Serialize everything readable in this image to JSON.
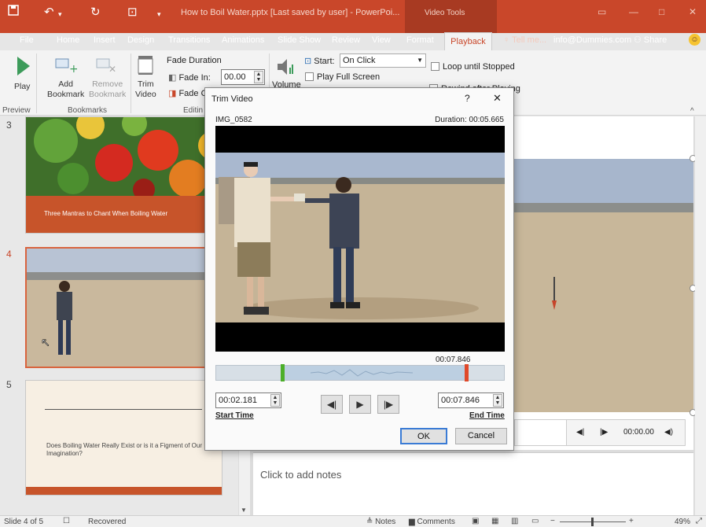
{
  "titlebar": {
    "save_icon": "save-icon",
    "undo": "↶",
    "undo_arrow": "▾",
    "redo": "↻",
    "present": "⊡",
    "customize": "▾",
    "doc_title": "How to Boil Water.pptx [Last saved by user] - PowerPoi...",
    "video_tools": "Video Tools",
    "min": "—",
    "max": "□",
    "close": "✕"
  },
  "tabs": [
    "File",
    "Home",
    "Insert",
    "Design",
    "Transitions",
    "Animations",
    "Slide Show",
    "Review",
    "View",
    "Format",
    "Playback"
  ],
  "tell_me": "♀ Tell me...",
  "account": "info@Dummies.com",
  "share": "Share",
  "smiley": "☺",
  "ribbon": {
    "play": "Play",
    "preview": "Preview",
    "add_bookmark": "Add\nBookmark",
    "remove_bookmark": "Remove\nBookmark",
    "bookmarks": "Bookmarks",
    "trim": "Trim\nVideo",
    "editing": "Editin",
    "fade_duration": "Fade Duration",
    "fade_in": "Fade In:",
    "fade_in_value": "00.00",
    "fade_out": "Fade O",
    "volume": "Volume",
    "start": "Start:",
    "start_value": "On Click",
    "loop": "Loop until Stopped",
    "full_screen": "Play Full Screen",
    "rewind": "Rewind after Playing"
  },
  "slides": [
    {
      "number": "3",
      "caption": "Three Mantras to Chant When Boiling Water"
    },
    {
      "number": "4",
      "caption": ""
    },
    {
      "number": "5",
      "caption": "Does Boiling Water Really Exist or is it a Figment of Our Imagination?"
    }
  ],
  "notes_placeholder": "Click to add notes",
  "player": {
    "back": "◀|",
    "fwd": "|▶",
    "time": "00:00.00",
    "vol": "◀)"
  },
  "status": {
    "slide": "Slide 4 of 5",
    "recovered": "Recovered",
    "notes": "Notes",
    "comments": "Comments",
    "zoom": "49%"
  },
  "dialog": {
    "title": "Trim Video",
    "help": "?",
    "close": "✕",
    "file": "IMG_0582",
    "duration": "Duration: 00:05.665",
    "marker_time": "00:07.846",
    "start_value": "00:02.181",
    "end_value": "00:07.846",
    "start_label": "Start Time",
    "end_label": "End Time",
    "ok": "OK",
    "cancel": "Cancel",
    "prev": "◀|",
    "play": "▶",
    "next": "|▶"
  },
  "colors": {
    "accent": "#c9472a",
    "slide_orange": "#c7542a",
    "trim_green": "#4caf2a",
    "trim_red": "#e0492a"
  }
}
